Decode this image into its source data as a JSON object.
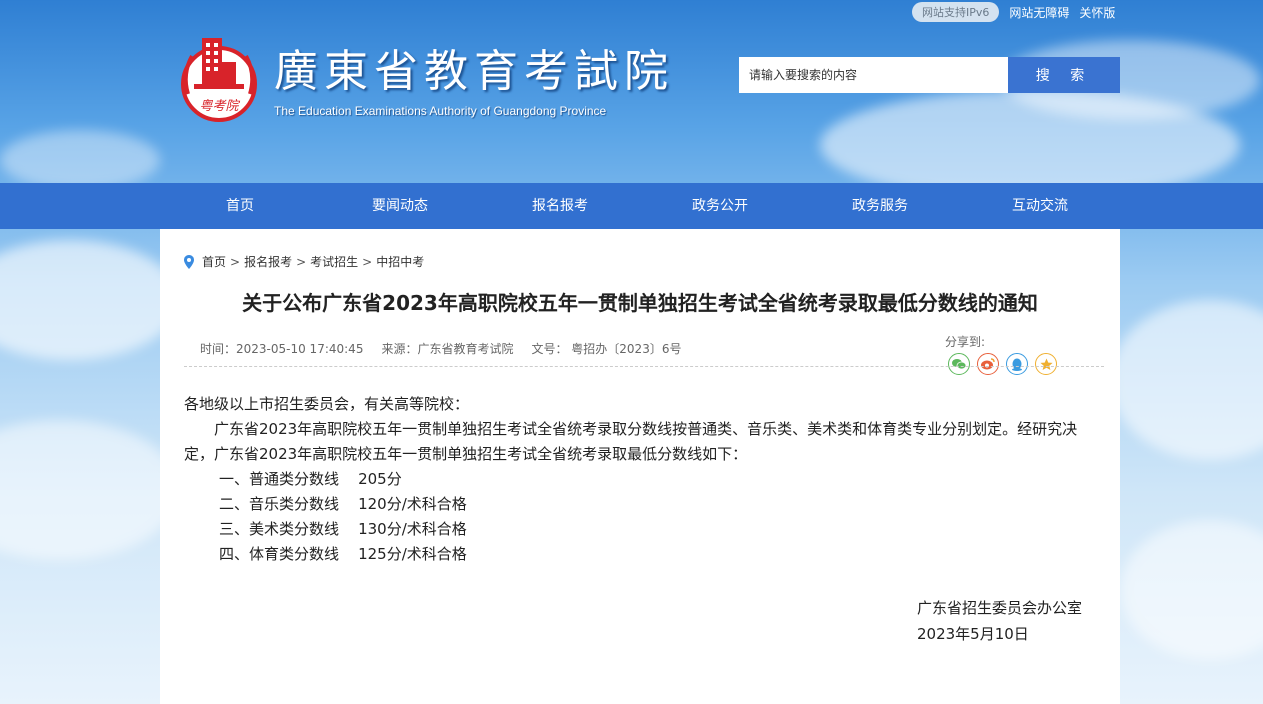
{
  "top_links": {
    "ipv6": "网站支持IPv6",
    "accessible": "网站无障碍",
    "care": "关怀版"
  },
  "logo": {
    "cn": "廣東省教育考試院",
    "en": "The Education Examinations Authority of Guangdong Province",
    "emblem_text": "粤考院"
  },
  "search": {
    "placeholder": "请输入要搜索的内容",
    "button": "搜 索"
  },
  "nav": [
    "首页",
    "要闻动态",
    "报名报考",
    "政务公开",
    "政务服务",
    "互动交流"
  ],
  "breadcrumb": [
    "首页",
    "报名报考",
    "考试招生",
    "中招中考"
  ],
  "article": {
    "title": "关于公布广东省2023年高职院校五年一贯制单独招生考试全省统考录取最低分数线的通知",
    "time": "时间：2023-05-10 17:40:45",
    "source": "来源：广东省教育考试院",
    "doc_no": "文号：  粤招办〔2023〕6号",
    "share_label": "分享到:",
    "salutation": "各地级以上市招生委员会，有关高等院校：",
    "paragraph": "广东省2023年高职院校五年一贯制单独招生考试全省统考录取分数线按普通类、音乐类、美术类和体育类专业分别划定。经研究决定，广东省2023年高职院校五年一贯制单独招生考试全省统考录取最低分数线如下：",
    "items": [
      "一、普通类分数线    205分",
      "二、音乐类分数线    120分/术科合格",
      "三、美术类分数线    130分/术科合格",
      "四、体育类分数线    125分/术科合格"
    ],
    "sign_org": "广东省招生委员会办公室",
    "sign_date": "2023年5月10日"
  },
  "colors": {
    "nav": "#3270d0",
    "search_button": "#3a73d1",
    "logo_red": "#d8232a"
  }
}
